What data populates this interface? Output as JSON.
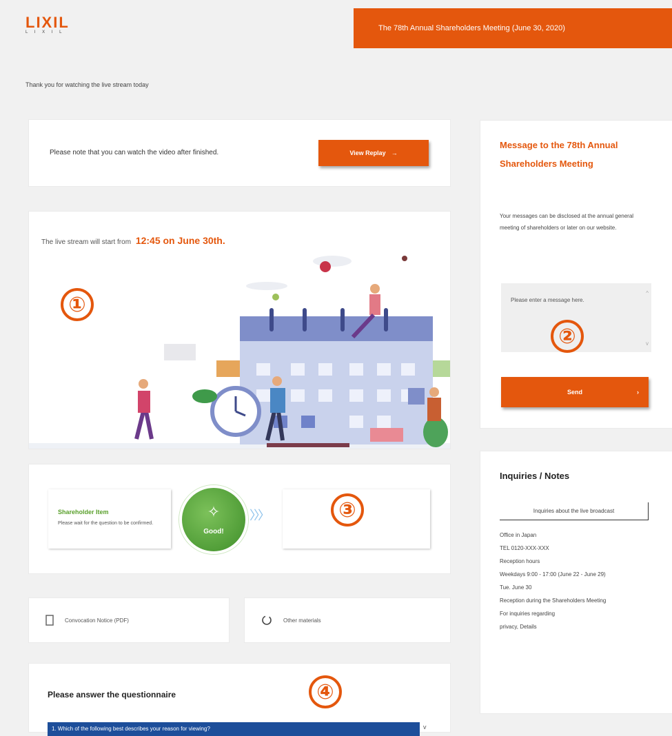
{
  "header": {
    "logo_text": "LIXIL",
    "logo_sub": "L I X I L",
    "meeting_banner": "The 78th Annual Shareholders Meeting (June 30, 2020)"
  },
  "thanks_text": "Thank you for watching the live stream today",
  "watch_card": {
    "text": "Please note that you can watch the video after finished.",
    "button_label": "View Replay"
  },
  "live_card": {
    "prefix": "The live stream will start from",
    "time": "12:45 on June 30th."
  },
  "message_card": {
    "title": "Message to the 78th Annual Shareholders Meeting",
    "desc": "Your messages can be disclosed at the annual general meeting of shareholders or later on our website.",
    "placeholder": "Please enter a message here.",
    "button_label": "Send",
    "scroll_up": "^",
    "scroll_down": "v"
  },
  "progress": {
    "step_title": "Shareholder Item",
    "step_desc": "Please wait for the question to be confirmed.",
    "good_label": "Good!"
  },
  "links": {
    "pdf_label": "Convocation Notice (PDF)",
    "other_label": "Other materials"
  },
  "inquiries": {
    "title": "Inquiries / Notes",
    "button_label": "Inquiries about the live broadcast",
    "lines": [
      "Office in Japan",
      "TEL 0120-XXX-XXX",
      "Reception hours",
      "Weekdays 9:00 - 17:00 (June 22 - June 29)",
      "Tue. June 30",
      "Reception during the Shareholders Meeting",
      "For inquiries regarding",
      "privacy, Details"
    ]
  },
  "questionnaire": {
    "title": "Please answer the questionnaire",
    "select_text": "1. Which of the following best describes your reason for viewing?",
    "arrow": "v"
  },
  "markers": {
    "m1": "①",
    "m2": "②",
    "m3": "③",
    "m4": "④"
  },
  "colors": {
    "accent": "#e4570d",
    "green": "#5aa02c",
    "select_blue": "#1d4e9a"
  }
}
